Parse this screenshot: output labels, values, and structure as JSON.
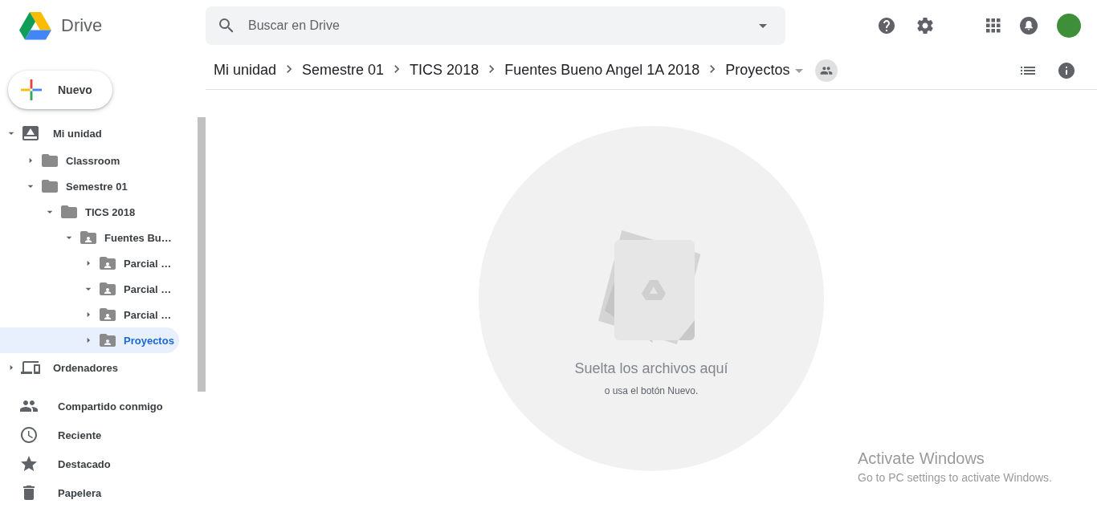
{
  "header": {
    "logo_text": "Drive",
    "search": {
      "placeholder": "Buscar en Drive"
    }
  },
  "new_button": {
    "label": "Nuevo"
  },
  "sidebar": {
    "tree": [
      {
        "label": "Mi unidad",
        "kind": "drive",
        "expanded": true,
        "selected": false,
        "children": [
          {
            "label": "Classroom",
            "kind": "folder",
            "expanded": false,
            "selected": false
          },
          {
            "label": "Semestre 01",
            "kind": "folder",
            "expanded": true,
            "selected": false,
            "children": [
              {
                "label": "TICS 2018",
                "kind": "folder",
                "expanded": true,
                "selected": false,
                "children": [
                  {
                    "label": "Fuentes Bu…",
                    "kind": "shared_folder",
                    "expanded": true,
                    "selected": false,
                    "children": [
                      {
                        "label": "Parcial …",
                        "kind": "shared_folder",
                        "expanded": false,
                        "selected": false
                      },
                      {
                        "label": "Parcial …",
                        "kind": "shared_folder",
                        "expanded": true,
                        "selected": false
                      },
                      {
                        "label": "Parcial …",
                        "kind": "shared_folder",
                        "expanded": false,
                        "selected": false
                      },
                      {
                        "label": "Proyectos",
                        "kind": "shared_folder",
                        "expanded": false,
                        "selected": true
                      }
                    ]
                  }
                ]
              }
            ]
          }
        ]
      },
      {
        "label": "Ordenadores",
        "kind": "computers",
        "expanded": false,
        "selected": false
      }
    ],
    "items": [
      {
        "label": "Compartido conmigo",
        "kind": "shared",
        "selected": false
      },
      {
        "label": "Reciente",
        "kind": "recent",
        "selected": false
      },
      {
        "label": "Destacado",
        "kind": "starred",
        "selected": false
      },
      {
        "label": "Papelera",
        "kind": "trash",
        "selected": false
      }
    ]
  },
  "breadcrumbs": [
    "Mi unidad",
    "Semestre 01",
    "TICS 2018",
    "Fuentes Bueno Angel 1A 2018",
    "Proyectos"
  ],
  "drop_zone": {
    "title": "Suelta los archivos aquí",
    "subtitle": "o usa el botón Nuevo."
  },
  "os_notice": {
    "title": "Activate Windows",
    "subtitle": "Go to PC settings to activate Windows."
  }
}
